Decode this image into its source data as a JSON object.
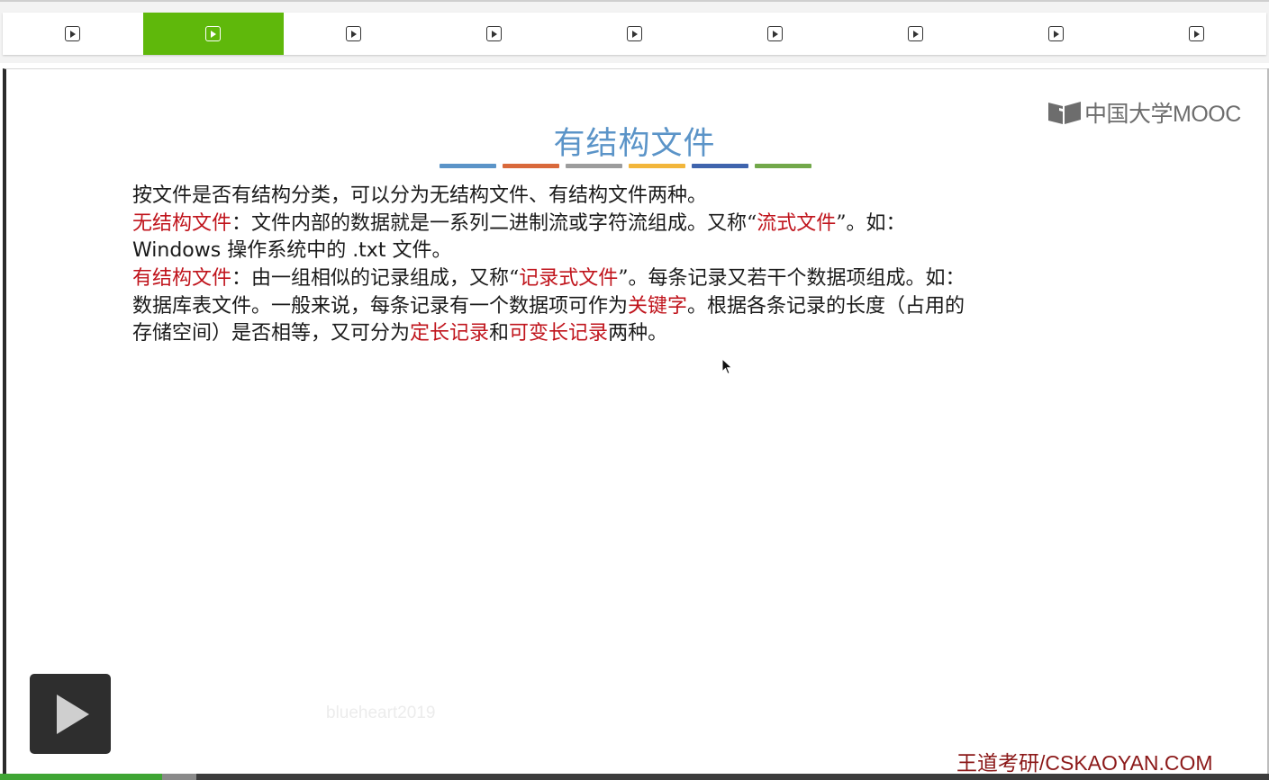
{
  "tabs": [
    {
      "icon": "play-icon",
      "active": false
    },
    {
      "icon": "play-icon",
      "active": true
    },
    {
      "icon": "play-icon",
      "active": false
    },
    {
      "icon": "play-icon",
      "active": false
    },
    {
      "icon": "play-icon",
      "active": false
    },
    {
      "icon": "play-icon",
      "active": false
    },
    {
      "icon": "play-icon",
      "active": false
    },
    {
      "icon": "play-icon",
      "active": false
    },
    {
      "icon": "play-icon",
      "active": false
    }
  ],
  "accent_color": "#5fb80b",
  "logo": {
    "text": "中国大学MOOC"
  },
  "slide": {
    "title": "有结构文件",
    "title_color": "#5b94c8",
    "title_bar_colors": [
      "#5b94c8",
      "#d9693b",
      "#9c9c9c",
      "#f2b63b",
      "#3f64ad",
      "#72a84a"
    ],
    "intro": "按文件是否有结构分类，可以分为无结构文件、有结构文件两种。",
    "unstructured": {
      "term": "无结构文件",
      "text1": "：文件内部的数据就是一系列二进制流或字符流组成。又称“",
      "alias": "流式文件",
      "text2": "”。如：",
      "line2": "Windows 操作系统中的 .txt 文件。"
    },
    "structured": {
      "term": "有结构文件",
      "text1": "：由一组相似的记录组成，又称“",
      "alias": "记录式文件",
      "text2": "”。每条记录又若干个数据项组成。如：",
      "line2a": "数据库表文件。一般来说，每条记录有一个数据项可作为",
      "key_term": "关键字",
      "line2b": "。根据各条记录的长度（占用的",
      "line3a": "存储空间）是否相等，又可分为",
      "fixed": "定长记录",
      "conj": "和",
      "variable": "可变长记录",
      "line3b": "两种。"
    },
    "highlight_color": "#c0141c"
  },
  "player": {
    "watermark": "blueheart2019",
    "brand": "王道考研/CSKAOYAN.COM",
    "progress_played": 0.128,
    "progress_buffered": 0.155
  }
}
